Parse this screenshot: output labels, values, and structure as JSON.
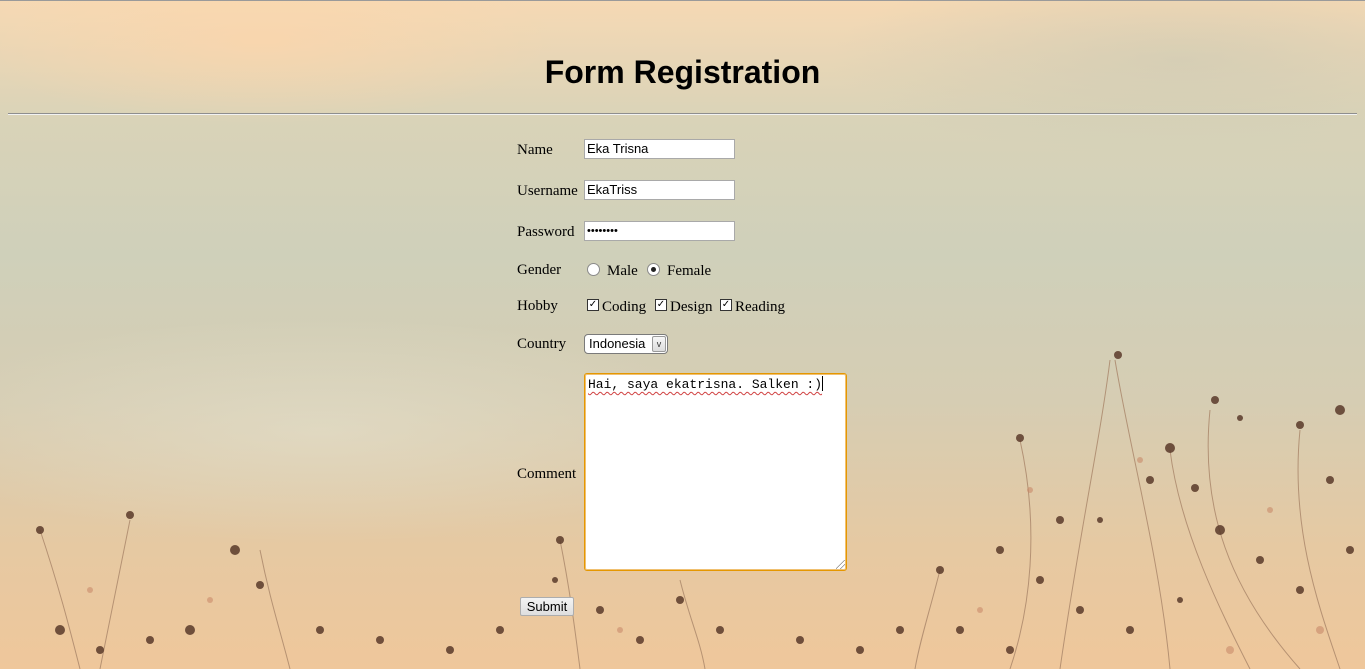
{
  "page": {
    "title": "Form Registration"
  },
  "form": {
    "name": {
      "label": "Name",
      "value": "Eka Trisna"
    },
    "username": {
      "label": "Username",
      "value": "EkaTriss"
    },
    "password": {
      "label": "Password",
      "value": "••••••••"
    },
    "gender": {
      "label": "Gender",
      "options": [
        "Male",
        "Female"
      ],
      "selected": "Female"
    },
    "hobby": {
      "label": "Hobby",
      "options": [
        {
          "label": "Coding",
          "checked": true
        },
        {
          "label": "Design",
          "checked": true
        },
        {
          "label": "Reading",
          "checked": true
        }
      ]
    },
    "country": {
      "label": "Country",
      "value": "Indonesia",
      "arrow": "v"
    },
    "comment": {
      "label": "Comment",
      "value": "Hai, saya ekatrisna. Salken :)"
    },
    "submit_label": "Submit"
  },
  "colors": {
    "textarea_focus": "#e59700",
    "spellcheck": "#d04040"
  }
}
